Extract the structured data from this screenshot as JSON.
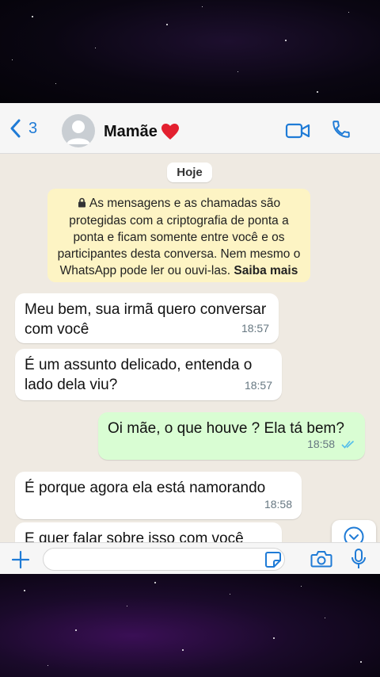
{
  "header": {
    "back_count": "3",
    "contact_name": "Mamãe",
    "icons": [
      "chevron-left-icon",
      "avatar",
      "heart-icon",
      "video-call-icon",
      "phone-call-icon"
    ]
  },
  "chat": {
    "date_label": "Hoje",
    "encryption_notice": {
      "text": "As mensagens e as chamadas são protegidas com a criptografia de ponta a ponta e ficam somente entre você e os participantes desta conversa. Nem mesmo o WhatsApp pode ler ou ouvi-las.",
      "link": "Saiba mais"
    },
    "messages": [
      {
        "direction": "in",
        "text": "Meu bem, sua irmã quero conversar com você",
        "time": "18:57"
      },
      {
        "direction": "in",
        "text": "É um assunto delicado, entenda o lado dela viu?",
        "time": "18:57"
      },
      {
        "direction": "out",
        "text": "Oi mãe, o que houve ? Ela tá bem?",
        "time": "18:58",
        "status": "read"
      },
      {
        "direction": "in",
        "text": "É porque agora ela está namorando",
        "time": "18:58"
      },
      {
        "direction": "in",
        "text": "E quer falar sobre isso com você",
        "time": ""
      }
    ]
  },
  "composer": {
    "placeholder": "",
    "icons": [
      "plus-icon",
      "sticker-icon",
      "camera-icon",
      "microphone-icon"
    ]
  },
  "colors": {
    "accent": "#1f7bd6",
    "outgoing_bubble": "#d9fdd3",
    "incoming_bubble": "#ffffff",
    "chat_background": "#efeae2",
    "encryption_bg": "#fdf4c4",
    "read_ticks": "#53bdeb"
  }
}
